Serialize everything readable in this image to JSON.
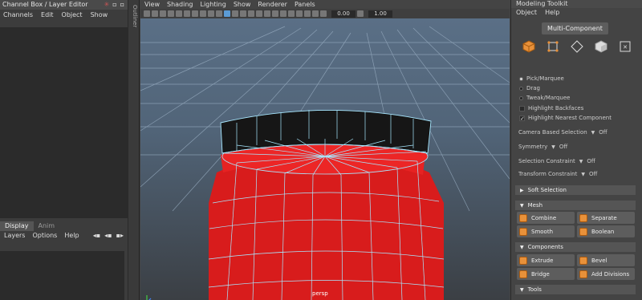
{
  "left_panel": {
    "title": "Channel Box / Layer Editor",
    "menu": [
      "Channels",
      "Edit",
      "Object",
      "Show"
    ],
    "layer_tabs": [
      "Display",
      "Anim"
    ],
    "layer_menu": [
      "Layers",
      "Options",
      "Help"
    ]
  },
  "outliner_label": "Outliner",
  "viewport": {
    "menu": [
      "View",
      "Shading",
      "Lighting",
      "Show",
      "Renderer",
      "Panels"
    ],
    "field_value": "0.00",
    "field_value2": "1.00",
    "camera_label": "persp"
  },
  "toolkit": {
    "title": "Modeling Toolkit",
    "menu": [
      "Object",
      "Help"
    ],
    "mode_button": "Multi-Component",
    "component_icons": [
      "object-mode-icon",
      "vertex-mode-icon",
      "edge-mode-icon",
      "face-mode-icon",
      "uv-mode-icon"
    ],
    "selection_modes": [
      "Pick/Marquee",
      "Drag",
      "Tweak/Marquee"
    ],
    "checkboxes": [
      {
        "label": "Highlight Backfaces",
        "checked": false
      },
      {
        "label": "Highlight Nearest Component",
        "checked": true
      }
    ],
    "options": [
      {
        "label": "Camera Based Selection",
        "value": "Off"
      },
      {
        "label": "Symmetry",
        "value": "Off"
      },
      {
        "label": "Selection Constraint",
        "value": "Off"
      },
      {
        "label": "Transform Constraint",
        "value": "Off"
      }
    ],
    "soft_selection": "Soft Selection",
    "mesh_section": "Mesh",
    "mesh_tools": [
      "Combine",
      "Separate",
      "Smooth",
      "Boolean"
    ],
    "components_section": "Components",
    "component_tools": [
      "Extrude",
      "Bevel",
      "Bridge",
      "Add Divisions"
    ],
    "tools_section": "Tools"
  },
  "colors": {
    "mesh_red": "#e01f1f",
    "wire": "#a8e8ff",
    "grid": "#9fb4c8"
  }
}
